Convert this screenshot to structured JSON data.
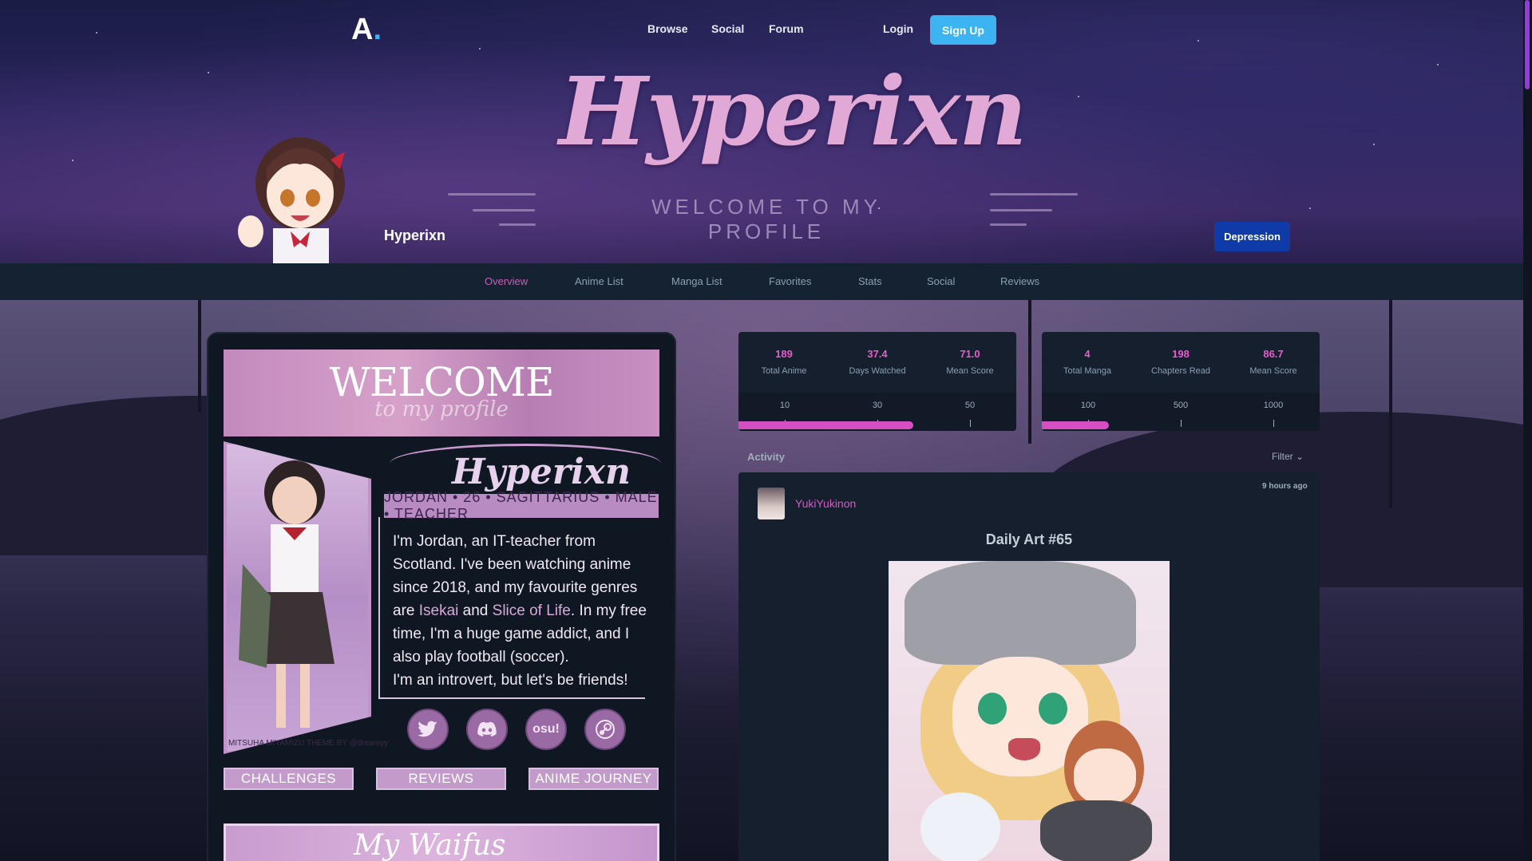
{
  "nav": {
    "logo": "A",
    "links": [
      "Browse",
      "Social",
      "Forum"
    ],
    "login": "Login",
    "signup": "Sign Up"
  },
  "banner": {
    "title": "Hyperixn",
    "subtitle": "WELCOME TO MY PROFILE"
  },
  "profile": {
    "name": "Hyperixn",
    "donator_badge": "Depression"
  },
  "tabs": [
    "Overview",
    "Anime List",
    "Manga List",
    "Favorites",
    "Stats",
    "Social",
    "Reviews"
  ],
  "active_tab": "Overview",
  "about": {
    "welcome": "WELCOME",
    "welcome_sub": "to my profile",
    "name": "Hyperixn",
    "info": "JORDAN • 26 • SAGITTARIUS • MALE • TEACHER",
    "bio_1": "I'm Jordan, an IT-teacher from Scotland. I've been watching anime since 2018, and my favourite genres are ",
    "genre_1": "Isekai",
    "bio_2": " and ",
    "genre_2": "Slice of Life",
    "bio_3": ". In my free time, I'm a huge game addict, and I also play football (soccer).",
    "bio_4": "I'm an introvert, but let's be friends!",
    "portrait_caption": "MITSUHA MIYAMIZU THEME BY @dreamyy",
    "socials": [
      "twitter-icon",
      "discord-icon",
      "osu-icon",
      "steam-icon"
    ],
    "osu_label": "osu!",
    "buttons": [
      "CHALLENGES",
      "REVIEWS",
      "ANIME JOURNEY"
    ],
    "waifus": "My Waifus"
  },
  "anime_stats": {
    "items": [
      {
        "value": "189",
        "label": "Total Anime"
      },
      {
        "value": "37.4",
        "label": "Days Watched"
      },
      {
        "value": "71.0",
        "label": "Mean Score"
      }
    ],
    "ticks": [
      "10",
      "30",
      "50"
    ],
    "progress": 0.63
  },
  "manga_stats": {
    "items": [
      {
        "value": "4",
        "label": "Total Manga"
      },
      {
        "value": "198",
        "label": "Chapters Read"
      },
      {
        "value": "86.7",
        "label": "Mean Score"
      }
    ],
    "ticks": [
      "100",
      "500",
      "1000"
    ],
    "progress": 0.24
  },
  "activity": {
    "title": "Activity",
    "filter": "Filter",
    "user": "YukiYukinon",
    "time": "9 hours ago",
    "post_title": "Daily Art #65"
  },
  "colors": {
    "accent": "#3db4f2",
    "stat_value": "#e85ccd",
    "tab_active": "#c063b4",
    "badge": "#0f3ba8"
  }
}
